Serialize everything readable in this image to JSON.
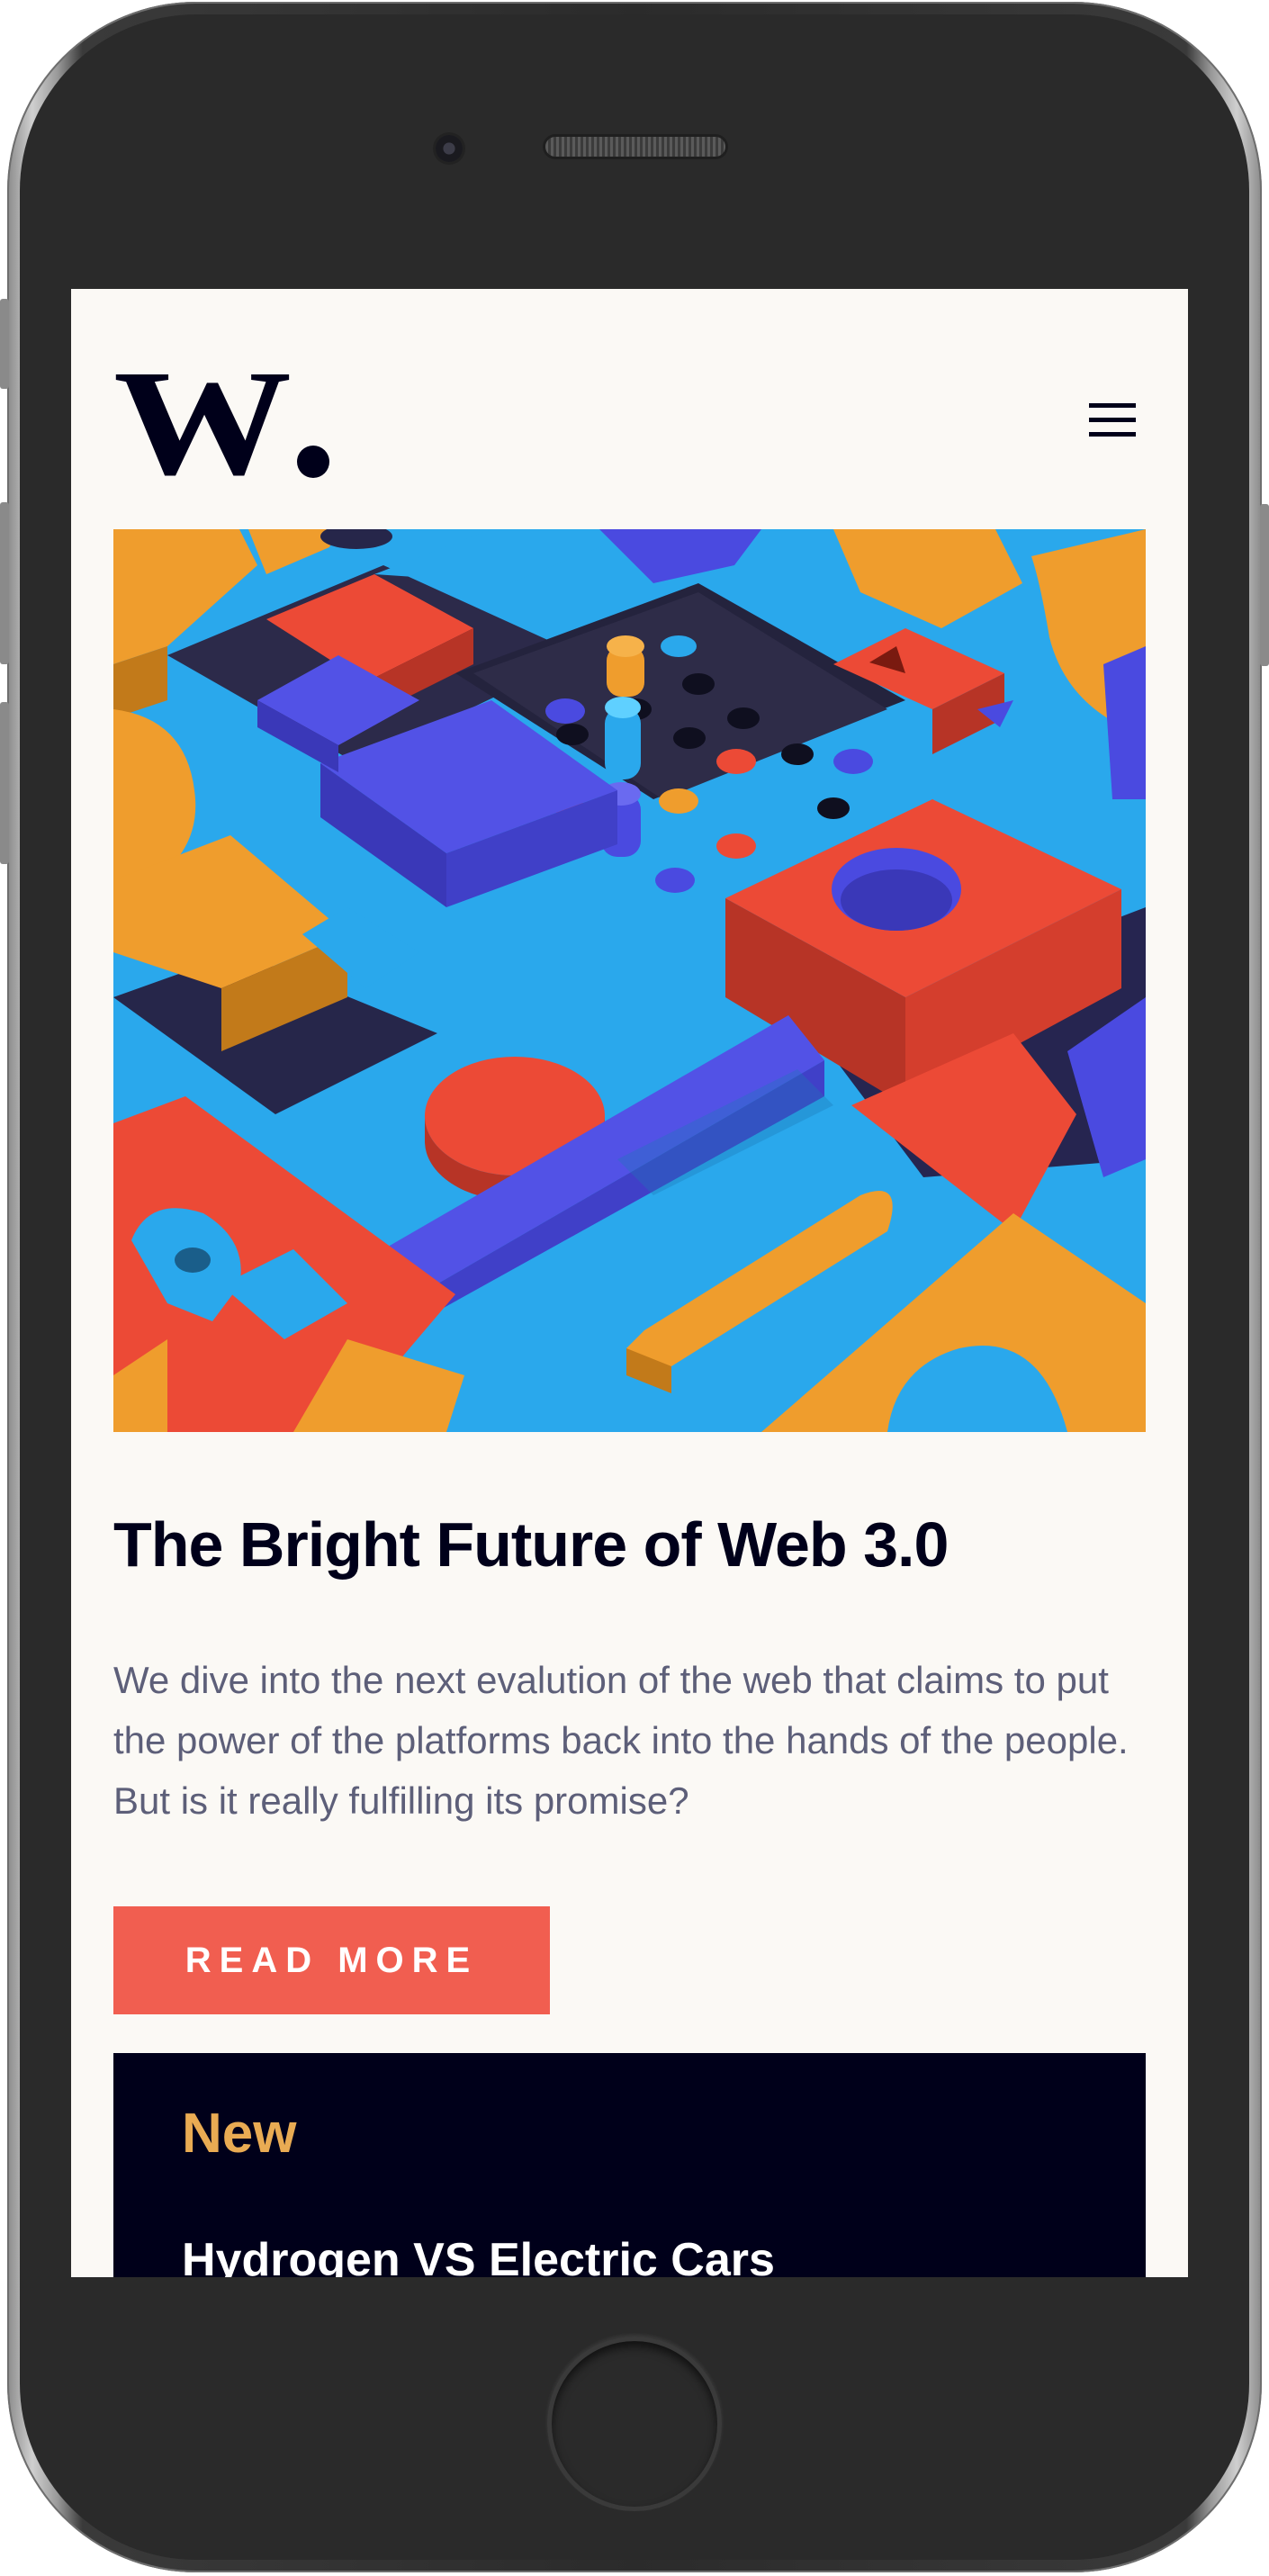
{
  "header": {
    "logo_text": "W",
    "menu_icon": "hamburger-menu-icon"
  },
  "hero": {
    "image_description_icon": "abstract-3d-blocks-image"
  },
  "article": {
    "title": "The Bright Future of Web 3.0",
    "excerpt": "We dive into the next evalution of the web that claims to put the power of the platforms back into the hands of the people. But is it really fulfilling its promise?",
    "read_more_label": "READ MORE"
  },
  "new_section": {
    "heading": "New",
    "items": [
      {
        "title": "Hydrogen VS Electric Cars"
      }
    ]
  },
  "colors": {
    "background": "#fbf9f5",
    "primary_dark": "#00001a",
    "accent_red": "#f15e50",
    "accent_orange": "#e9ab53",
    "text_gray": "#5d5f79"
  }
}
